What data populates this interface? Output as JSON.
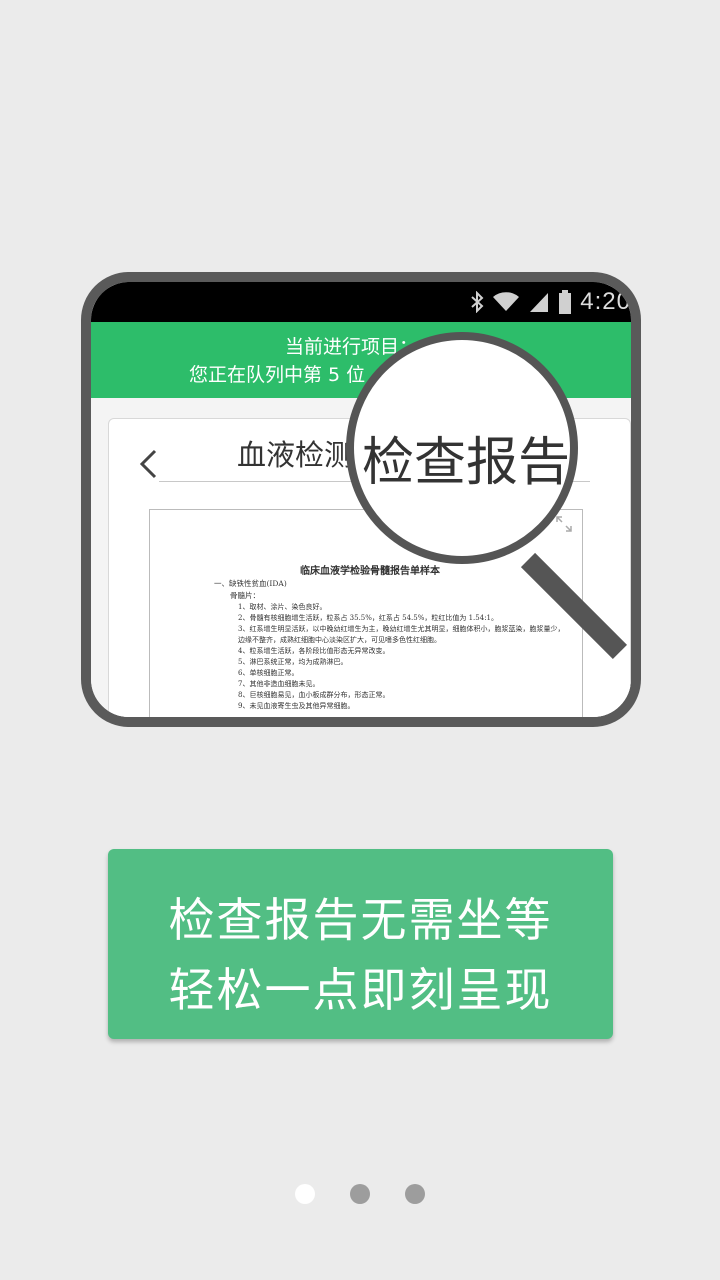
{
  "status_bar": {
    "time": "4:20"
  },
  "app_header": {
    "line1": "当前进行项目：",
    "line2": "您正在队列中第 5 位"
  },
  "report_card": {
    "title": "血液检测",
    "magnified_text": "检查报告"
  },
  "report_document": {
    "title": "临床血液学检验骨髓报告单样本",
    "section": "一、缺铁性贫血(IDA)",
    "subsection": "骨髓片：",
    "items": [
      "1、取材、涂片、染色良好。",
      "2、骨髓有核细胞增生活跃，粒系占 35.5%，红系占 54.5%，粒红比值为 1.54:1。",
      "3、红系增生明显活跃，以中晚幼红增生为主，晚幼红增生尤其明显，细胞体积小，胞浆蓝染，胞浆量少，边缘不整齐，成熟红细胞中心淡染区扩大，可见嗜多色性红细胞。",
      "4、粒系增生活跃，各阶段比值形态无异常改变。",
      "5、淋巴系统正常，均为成熟淋巴。",
      "6、单核细胞正常。",
      "7、其他非造血细胞未见。",
      "8、巨核细胞易见，血小板成群分布，形态正常。",
      "9、未见血液寄生虫及其他异常细胞。"
    ]
  },
  "banner": {
    "line1": "检查报告无需坐等",
    "line2": "轻松一点即刻呈现"
  },
  "pager": {
    "count": 3,
    "active": 0
  },
  "colors": {
    "header_green": "#2dbd6a",
    "banner_green": "#52be84",
    "background": "#ebebeb"
  }
}
